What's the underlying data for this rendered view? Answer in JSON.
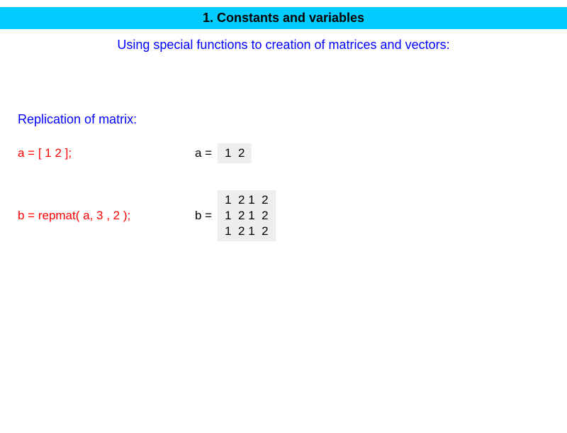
{
  "title": "1. Constants and variables",
  "subtitle": "Using special functions to creation of matrices and vectors:",
  "section": "Replication of matrix:",
  "line1": {
    "code": "a = [ 1  2 ];",
    "label": "a =",
    "matrix": "1  2"
  },
  "line2": {
    "code": "b = repmat( a,  3 , 2 );",
    "label": "b =",
    "matrix": "1  2 1  2\n1  2 1  2\n1  2 1  2"
  }
}
